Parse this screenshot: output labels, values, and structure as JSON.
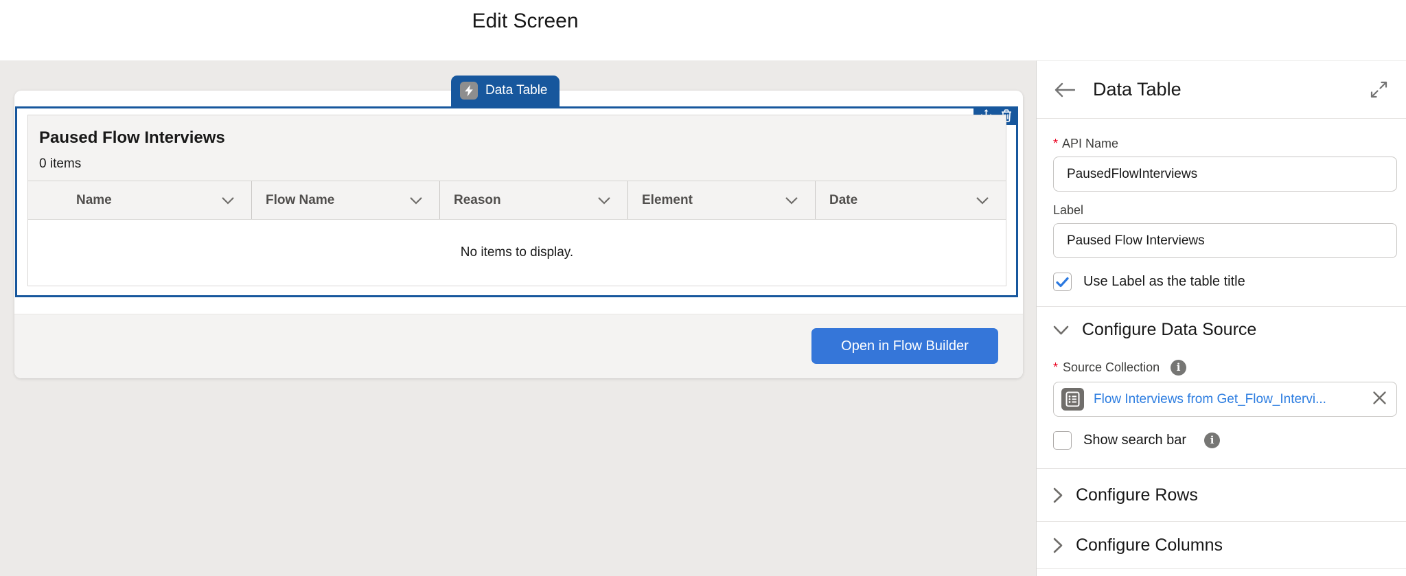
{
  "header": {
    "title": "Edit Screen"
  },
  "canvas": {
    "component_badge": {
      "label": "Data Table"
    },
    "table": {
      "title": "Paused Flow Interviews",
      "items_count": "0 items",
      "columns": [
        "Name",
        "Flow Name",
        "Reason",
        "Element",
        "Date"
      ],
      "empty_message": "No items to display."
    },
    "open_button_label": "Open in Flow Builder"
  },
  "panel": {
    "title": "Data Table",
    "required_marker": "*",
    "api_name": {
      "label": "API Name",
      "value": "PausedFlowInterviews"
    },
    "label_field": {
      "label": "Label",
      "value": "Paused Flow Interviews"
    },
    "use_label_checkbox": {
      "label": "Use Label as the table title",
      "checked": true
    },
    "configure_data_source": {
      "label": "Configure Data Source"
    },
    "source_collection": {
      "label": "Source Collection",
      "value": "Flow Interviews from Get_Flow_Intervi..."
    },
    "show_search_checkbox": {
      "label": "Show search bar",
      "checked": false
    },
    "configure_rows": {
      "label": "Configure Rows"
    },
    "configure_columns": {
      "label": "Configure Columns"
    }
  },
  "colors": {
    "selection_blue": "#17579d",
    "brand_button_blue": "#3576d9",
    "link_blue": "#2b7ce0",
    "canvas_background": "#eceae8",
    "widget_chrome": "#f4f3f2",
    "required_red": "#ea001e"
  }
}
